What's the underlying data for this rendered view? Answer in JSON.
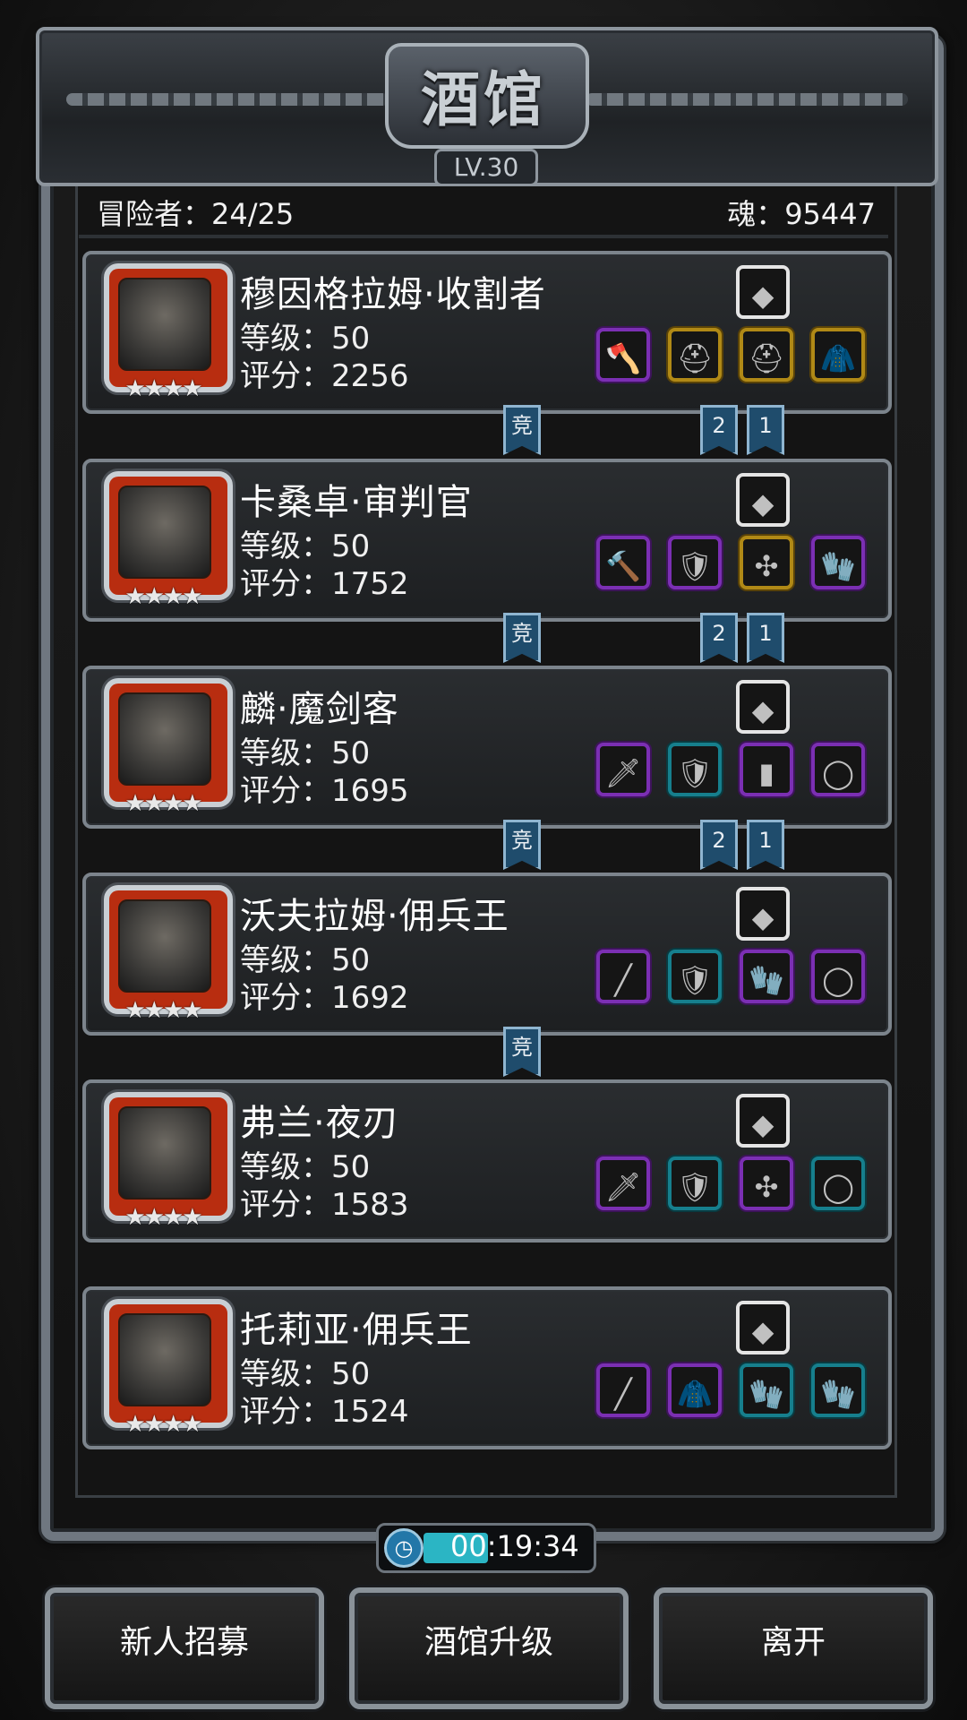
{
  "header": {
    "title": "酒馆",
    "level": "LV.30"
  },
  "summary": {
    "adventurers": "冒险者：24/25",
    "souls": "魂：95447"
  },
  "heroes": [
    {
      "name": "穆因格拉姆·收割者",
      "level": "等级：50",
      "score": "评分：2256",
      "stars": "★★★★",
      "accessory_icon": "gauntlet-icon",
      "gear": [
        {
          "icon": "axe-icon",
          "glyph": "🪓"
        },
        {
          "icon": "helmet-icon",
          "glyph": "⛑"
        },
        {
          "icon": "helmet-icon",
          "glyph": "⛑"
        },
        {
          "icon": "cloak-icon",
          "glyph": "🧥"
        }
      ],
      "gear_rarity": [
        "purple",
        "gold",
        "gold",
        "gold"
      ],
      "badges": [
        "竞",
        "2",
        "1"
      ]
    },
    {
      "name": "卡桑卓·审判官",
      "level": "等级：50",
      "score": "评分：1752",
      "stars": "★★★★",
      "accessory_icon": "fur-icon",
      "gear": [
        {
          "icon": "hammer-icon",
          "glyph": "🔨"
        },
        {
          "icon": "armor-icon",
          "glyph": "🛡"
        },
        {
          "icon": "amulet-icon",
          "glyph": "✣"
        },
        {
          "icon": "gauntlet-icon",
          "glyph": "🧤"
        }
      ],
      "gear_rarity": [
        "purple",
        "purple",
        "gold",
        "purple"
      ],
      "badges": [
        "竞",
        "2",
        "1"
      ]
    },
    {
      "name": "麟·魔剑客",
      "level": "等级：50",
      "score": "评分：1695",
      "stars": "★★★★",
      "accessory_icon": "scabbard-icon",
      "gear": [
        {
          "icon": "sword-icon",
          "glyph": "🗡"
        },
        {
          "icon": "armor-icon",
          "glyph": "🛡"
        },
        {
          "icon": "plank-icon",
          "glyph": "▮"
        },
        {
          "icon": "ring-icon",
          "glyph": "◯"
        }
      ],
      "gear_rarity": [
        "purple",
        "teal",
        "purple",
        "purple"
      ],
      "badges": [
        "竞",
        "2",
        "1"
      ]
    },
    {
      "name": "沃夫拉姆·佣兵王",
      "level": "等级：50",
      "score": "评分：1692",
      "stars": "★★★★",
      "accessory_icon": "heart-gem-icon",
      "gear": [
        {
          "icon": "spear-icon",
          "glyph": "╱"
        },
        {
          "icon": "armor-icon",
          "glyph": "🛡"
        },
        {
          "icon": "gauntlet-icon",
          "glyph": "🧤"
        },
        {
          "icon": "ring-icon",
          "glyph": "◯"
        }
      ],
      "gear_rarity": [
        "purple",
        "teal",
        "purple",
        "purple"
      ],
      "badges": [
        "竞"
      ]
    },
    {
      "name": "弗兰·夜刃",
      "level": "等级：50",
      "score": "评分：1583",
      "stars": "★★★★",
      "accessory_icon": "pendant-icon",
      "gear": [
        {
          "icon": "dagger-icon",
          "glyph": "🗡"
        },
        {
          "icon": "armor-icon",
          "glyph": "🛡"
        },
        {
          "icon": "amulet-icon",
          "glyph": "✣"
        },
        {
          "icon": "ring-icon",
          "glyph": "◯"
        }
      ],
      "gear_rarity": [
        "purple",
        "teal",
        "purple",
        "teal"
      ],
      "badges": []
    },
    {
      "name": "托莉亚·佣兵王",
      "level": "等级：50",
      "score": "评分：1524",
      "stars": "★★★★",
      "accessory_icon": "knife-icon",
      "gear": [
        {
          "icon": "spear-icon",
          "glyph": "╱"
        },
        {
          "icon": "cloak-icon",
          "glyph": "🧥"
        },
        {
          "icon": "gauntlet-icon",
          "glyph": "🧤"
        },
        {
          "icon": "gauntlet-icon",
          "glyph": "🧤"
        }
      ],
      "gear_rarity": [
        "purple",
        "purple",
        "teal",
        "teal"
      ],
      "badges": []
    }
  ],
  "timer": {
    "time": "00:19:34",
    "fill_fraction": 0.3
  },
  "buttons": {
    "recruit": "新人招募",
    "upgrade": "酒馆升级",
    "leave": "离开"
  },
  "colors": {
    "purple": "#7b2fb3",
    "gold": "#b08916",
    "teal": "#167f8d",
    "portrait_red": "#b82d10"
  }
}
